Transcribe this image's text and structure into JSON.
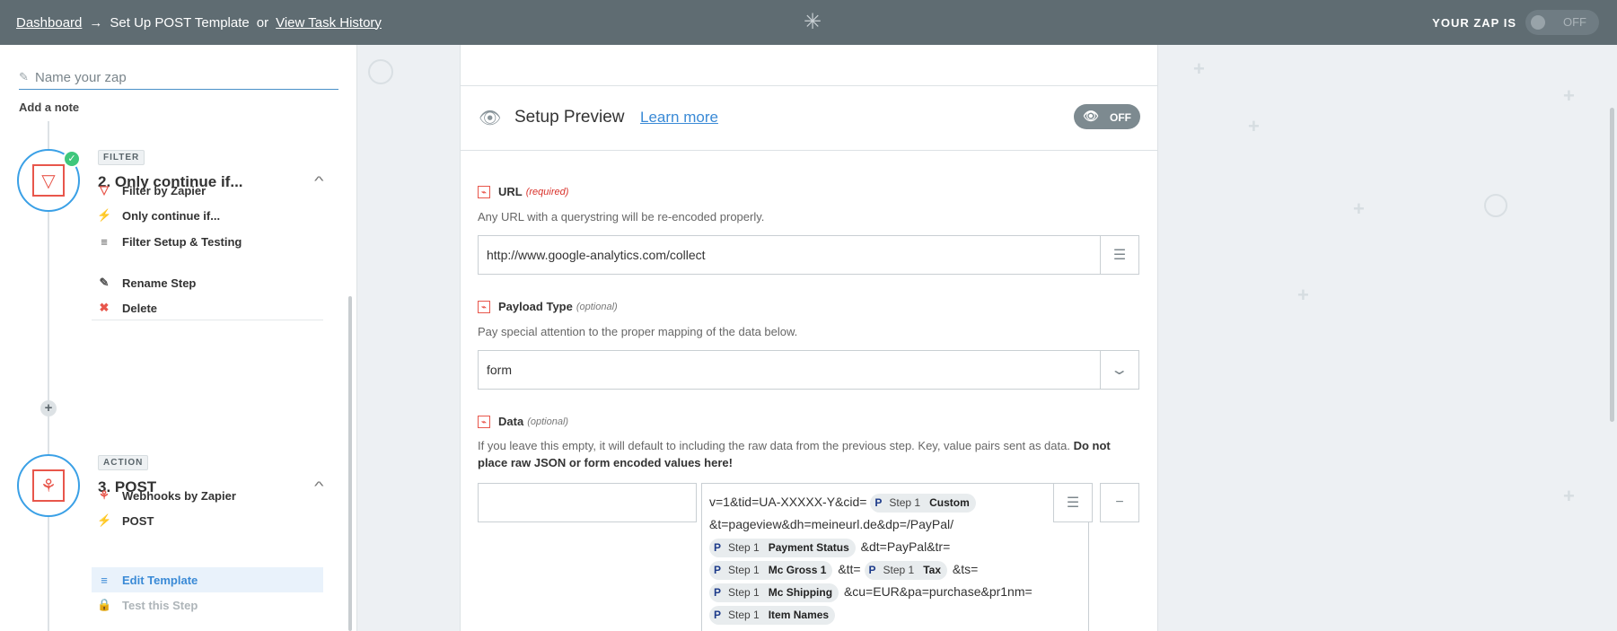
{
  "topbar": {
    "dashboard_link": "Dashboard",
    "arrow": "→",
    "current": "Set Up POST Template",
    "or": "or",
    "history_link": "View Task History",
    "logo_icon": "zapier-asterisk-icon",
    "zap_status_label": "YOUR ZAP IS",
    "zap_toggle": "OFF"
  },
  "sidebar": {
    "zap_name_placeholder": "Name your zap",
    "add_note": "Add a note",
    "steps": [
      {
        "badge": "FILTER",
        "title": "2. Only continue if...",
        "completed": true,
        "items": [
          {
            "label": "Filter by Zapier",
            "icon": "filter-icon"
          },
          {
            "label": "Only continue if...",
            "icon": "bolt-icon"
          },
          {
            "label": "Filter Setup & Testing",
            "icon": "list-icon"
          }
        ],
        "actions": [
          {
            "label": "Rename Step",
            "icon": "pencil-icon"
          },
          {
            "label": "Delete",
            "icon": "delete-x-icon"
          }
        ]
      },
      {
        "badge": "ACTION",
        "title": "3. POST",
        "items": [
          {
            "label": "Webhooks by Zapier",
            "icon": "webhook-icon"
          },
          {
            "label": "POST",
            "icon": "bolt-icon"
          },
          {
            "label": "Edit Template",
            "icon": "list-icon",
            "selected": true
          },
          {
            "label": "Test this Step",
            "icon": "lock-icon",
            "disabled": true
          }
        ]
      }
    ]
  },
  "preview": {
    "title": "Setup Preview",
    "learn_more": "Learn more",
    "toggle": "OFF"
  },
  "fields": {
    "url": {
      "label": "URL",
      "required": "(required)",
      "help": "Any URL with a querystring will be re-encoded properly.",
      "value": "http://www.google-analytics.com/collect"
    },
    "payload": {
      "label": "Payload Type",
      "optional": "(optional)",
      "help": "Pay special attention to the proper mapping of the data below.",
      "value": "form"
    },
    "data": {
      "label": "Data",
      "optional": "(optional)",
      "help": "If you leave this empty, it will default to including the raw data from the previous step. Key, value pairs sent as data.",
      "help_bold": "Do not place raw JSON or form encoded values here!",
      "key_value": "",
      "remove_label": "−",
      "text_segments": {
        "t1": "v=1&tid=UA-XXXXX-Y&cid=",
        "t2": "&t=pageview&dh=meineurl.de&dp=/PayPal/",
        "t3": "&dt=PayPal&tr=",
        "t4": "&tt=",
        "t5": "&ts=",
        "t6": "&cu=EUR&pa=purchase&pr1nm="
      },
      "pills": {
        "step": "Step 1",
        "p1": "Custom",
        "p2": "Payment Status",
        "p3": "Mc Gross 1",
        "p4": "Tax",
        "p5": "Mc Shipping",
        "p6": "Item Names"
      }
    }
  },
  "colors": {
    "topbar": "#5f6c72",
    "accent_blue": "#3a8ad6",
    "zapier_red": "#e8564b",
    "success_green": "#3fc77c"
  }
}
